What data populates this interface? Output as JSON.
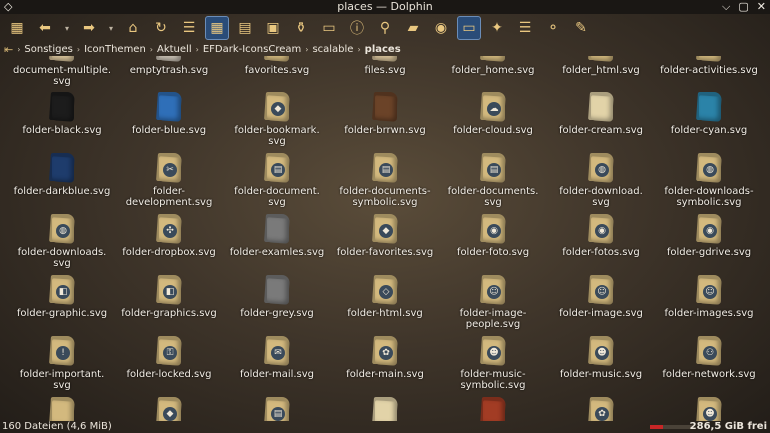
{
  "window": {
    "title": "places — Dolphin"
  },
  "titlebar": {
    "menu_glyph": "◇",
    "buttons": [
      "⌵",
      "▢",
      "✕"
    ]
  },
  "toolbar": {
    "buttons": [
      {
        "icon": "view-mode-icon",
        "glyph": "▦"
      },
      {
        "icon": "back-icon",
        "glyph": "⬅"
      },
      {
        "icon": "back-history-icon",
        "glyph": "▾"
      },
      {
        "icon": "forward-icon",
        "glyph": "➡"
      },
      {
        "icon": "forward-history-icon",
        "glyph": "▾"
      },
      {
        "icon": "home-icon",
        "glyph": "⌂"
      },
      {
        "icon": "reload-icon",
        "glyph": "↻"
      },
      {
        "icon": "details-view-icon",
        "glyph": "☰"
      },
      {
        "icon": "icons-view-icon",
        "glyph": "▦"
      },
      {
        "icon": "compact-view-icon",
        "glyph": "▤"
      },
      {
        "icon": "preview-icon",
        "glyph": "▣"
      },
      {
        "icon": "filter-icon",
        "glyph": "⚱"
      },
      {
        "icon": "terminal-icon",
        "glyph": "▭"
      },
      {
        "icon": "info-icon",
        "glyph": "ⓘ"
      },
      {
        "icon": "find-icon",
        "glyph": "⚲"
      },
      {
        "icon": "new-folder-icon",
        "glyph": "▰"
      },
      {
        "icon": "settings-icon",
        "glyph": "◉"
      },
      {
        "icon": "split-icon",
        "glyph": "▭"
      },
      {
        "icon": "tool-icon",
        "glyph": "✦"
      },
      {
        "icon": "menu-icon",
        "glyph": "☰"
      },
      {
        "icon": "bulb-icon",
        "glyph": "⚬"
      },
      {
        "icon": "wrench-icon",
        "glyph": "✎"
      }
    ]
  },
  "breadcrumb": {
    "root_glyph": "⇤",
    "items": [
      "Sonstiges",
      "IconThemen",
      "Aktuell",
      "EFDark-IconsCream",
      "scalable",
      "places"
    ]
  },
  "files": [
    {
      "name": "document-multiple.\nsvg",
      "color": "#d8c39a",
      "badge": ""
    },
    {
      "name": "emptytrash.svg",
      "color": "#c9c1b4",
      "badge": ""
    },
    {
      "name": "favorites.svg",
      "color": "#d3b97e",
      "badge": ""
    },
    {
      "name": "files.svg",
      "color": "#d8c39a",
      "badge": ""
    },
    {
      "name": "folder_home.svg",
      "color": "#d3b97e",
      "badge": ""
    },
    {
      "name": "folder_html.svg",
      "color": "#d3b97e",
      "badge": ""
    },
    {
      "name": "folder-activities.svg",
      "color": "#d3b97e",
      "badge": ""
    },
    {
      "name": "folder-black.svg",
      "color": "#1c1c1c",
      "badge": ""
    },
    {
      "name": "folder-blue.svg",
      "color": "#2f6fb8",
      "badge": ""
    },
    {
      "name": "folder-bookmark.\nsvg",
      "color": "#d3b97e",
      "badge": "◆"
    },
    {
      "name": "folder-brrwn.svg",
      "color": "#6b4328",
      "badge": ""
    },
    {
      "name": "folder-cloud.svg",
      "color": "#d3b97e",
      "badge": "☁"
    },
    {
      "name": "folder-cream.svg",
      "color": "#e2d3a8",
      "badge": ""
    },
    {
      "name": "folder-cyan.svg",
      "color": "#2b83a8",
      "badge": ""
    },
    {
      "name": "folder-darkblue.svg",
      "color": "#1e3c6c",
      "badge": ""
    },
    {
      "name": "folder-\ndevelopment.svg",
      "color": "#d3b97e",
      "badge": "✂"
    },
    {
      "name": "folder-document.\nsvg",
      "color": "#d3b97e",
      "badge": "▤"
    },
    {
      "name": "folder-documents-\nsymbolic.svg",
      "color": "#d3b97e",
      "badge": "▤"
    },
    {
      "name": "folder-documents.\nsvg",
      "color": "#d3b97e",
      "badge": "▤"
    },
    {
      "name": "folder-download.\nsvg",
      "color": "#d3b97e",
      "badge": "◍"
    },
    {
      "name": "folder-downloads-\nsymbolic.svg",
      "color": "#d3b97e",
      "badge": "◍"
    },
    {
      "name": "folder-downloads.\nsvg",
      "color": "#d3b97e",
      "badge": "◍"
    },
    {
      "name": "folder-dropbox.svg",
      "color": "#d3b97e",
      "badge": "✣"
    },
    {
      "name": "folder-examles.svg",
      "color": "#7a7a7a",
      "badge": ""
    },
    {
      "name": "folder-favorites.svg",
      "color": "#d3b97e",
      "badge": "◆"
    },
    {
      "name": "folder-foto.svg",
      "color": "#d3b97e",
      "badge": "◉"
    },
    {
      "name": "folder-fotos.svg",
      "color": "#d3b97e",
      "badge": "◉"
    },
    {
      "name": "folder-gdrive.svg",
      "color": "#d3b97e",
      "badge": "◉"
    },
    {
      "name": "folder-graphic.svg",
      "color": "#d3b97e",
      "badge": "◧"
    },
    {
      "name": "folder-graphics.svg",
      "color": "#d3b97e",
      "badge": "◧"
    },
    {
      "name": "folder-grey.svg",
      "color": "#7a7a7a",
      "badge": ""
    },
    {
      "name": "folder-html.svg",
      "color": "#d3b97e",
      "badge": "◇"
    },
    {
      "name": "folder-image-\npeople.svg",
      "color": "#d3b97e",
      "badge": "☺"
    },
    {
      "name": "folder-image.svg",
      "color": "#d3b97e",
      "badge": "☺"
    },
    {
      "name": "folder-images.svg",
      "color": "#d3b97e",
      "badge": "☺"
    },
    {
      "name": "folder-important.\nsvg",
      "color": "#d3b97e",
      "badge": "!"
    },
    {
      "name": "folder-locked.svg",
      "color": "#d3b97e",
      "badge": "⚿"
    },
    {
      "name": "folder-mail.svg",
      "color": "#d3b97e",
      "badge": "✉"
    },
    {
      "name": "folder-main.svg",
      "color": "#d3b97e",
      "badge": "✿"
    },
    {
      "name": "folder-music-\nsymbolic.svg",
      "color": "#d3b97e",
      "badge": "☻"
    },
    {
      "name": "folder-music.svg",
      "color": "#d3b97e",
      "badge": "☻"
    },
    {
      "name": "folder-network.svg",
      "color": "#d3b97e",
      "badge": "⚇"
    },
    {
      "name": "",
      "color": "#d3b97e",
      "badge": ""
    },
    {
      "name": "",
      "color": "#d3b97e",
      "badge": "◆"
    },
    {
      "name": "",
      "color": "#d3b97e",
      "badge": "▤"
    },
    {
      "name": "",
      "color": "#e2d3a8",
      "badge": ""
    },
    {
      "name": "",
      "color": "#a23c24",
      "badge": ""
    },
    {
      "name": "",
      "color": "#d3b97e",
      "badge": "✿"
    },
    {
      "name": "",
      "color": "#d3b97e",
      "badge": "☻"
    }
  ],
  "statusbar": {
    "summary": "160 Dateien (4,6 MiB)",
    "free_space": "286,5 GiB frei",
    "disk_used_fraction": 0.3
  }
}
